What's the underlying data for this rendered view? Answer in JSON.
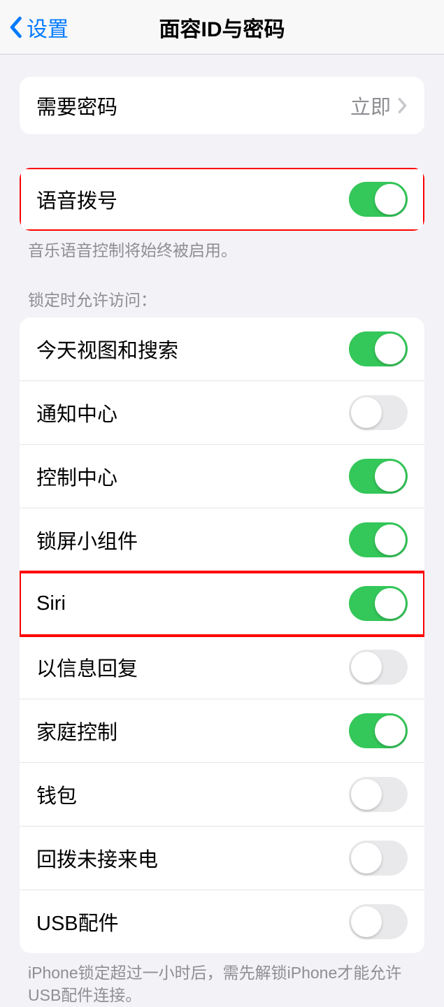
{
  "nav": {
    "back_label": "设置",
    "title": "面容ID与密码"
  },
  "passcode_section": {
    "require_passcode": {
      "label": "需要密码",
      "value": "立即"
    }
  },
  "voice_dial": {
    "label": "语音拨号",
    "on": true,
    "footer": "音乐语音控制将始终被启用。"
  },
  "lock_screen_access": {
    "header": "锁定时允许访问：",
    "items": [
      {
        "label": "今天视图和搜索",
        "on": true
      },
      {
        "label": "通知中心",
        "on": false
      },
      {
        "label": "控制中心",
        "on": true
      },
      {
        "label": "锁屏小组件",
        "on": true
      },
      {
        "label": "Siri",
        "on": true
      },
      {
        "label": "以信息回复",
        "on": false
      },
      {
        "label": "家庭控制",
        "on": true
      },
      {
        "label": "钱包",
        "on": false
      },
      {
        "label": "回拨未接来电",
        "on": false
      },
      {
        "label": "USB配件",
        "on": false
      }
    ],
    "footer": "iPhone锁定超过一小时后，需先解锁iPhone才能允许USB配件连接。"
  }
}
